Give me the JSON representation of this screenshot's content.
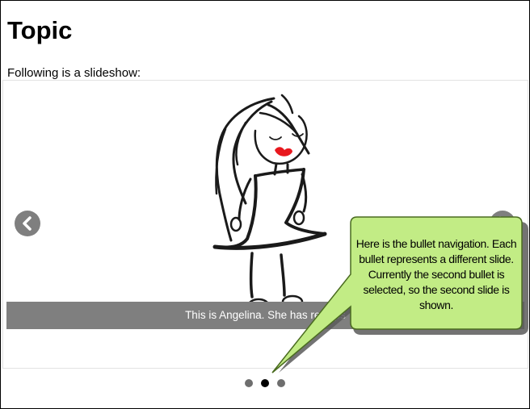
{
  "page": {
    "title": "Topic",
    "intro": "Following is a slideshow:"
  },
  "slideshow": {
    "caption": "This is Angelina. She has red lips",
    "prev_icon": "chevron-left-icon",
    "next_icon": "chevron-right-icon",
    "bullets": [
      {
        "active": false
      },
      {
        "active": true
      },
      {
        "active": false
      }
    ],
    "colors": {
      "lips": "#e8181e",
      "caption_bar": "#7f7f7f",
      "arrow_bg": "#7f7f7f"
    }
  },
  "callout": {
    "text": "Here is the bullet navigation. Each bullet represents a different slide. Currently the second bullet is selected, so the second slide is shown.",
    "fill": "#c2ec85",
    "border": "#4a6b20"
  }
}
